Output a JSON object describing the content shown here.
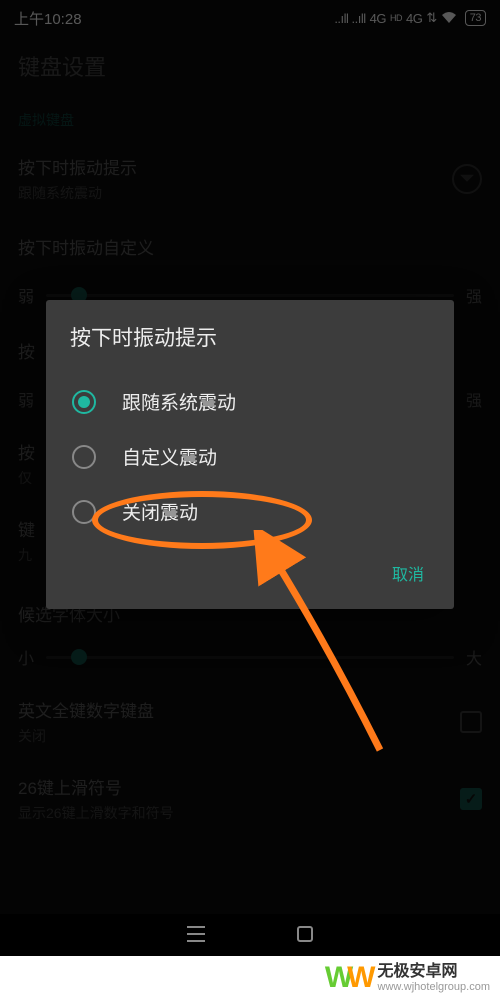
{
  "status": {
    "time": "上午10:28",
    "signal": "..ıll ..ıll",
    "net1": "4G",
    "hd": "HD",
    "net2": "4G",
    "wifi": "⇅",
    "battery": "73"
  },
  "page": {
    "title": "键盘设置",
    "section1": "虚拟键盘"
  },
  "items": {
    "vibrate": {
      "title": "按下时振动提示",
      "sub": "跟随系统震动"
    },
    "vibrate_custom": {
      "title": "按下时振动自定义"
    },
    "slider1": {
      "min": "弱",
      "max": "强",
      "pos": 8
    },
    "item3": {
      "title": "按"
    },
    "slider2": {
      "min": "弱",
      "max": "强",
      "pos": 8
    },
    "item4": {
      "title": "按",
      "sub": "仅"
    },
    "item5": {
      "title": "键",
      "sub": "九"
    },
    "font_size": {
      "title": "候选字体大小"
    },
    "slider3": {
      "min": "小",
      "max": "大",
      "pos": 8
    },
    "en_numpad": {
      "title": "英文全键数字键盘",
      "sub": "关闭"
    },
    "key26": {
      "title": "26键上滑符号",
      "sub": "显示26键上滑数字和符号"
    }
  },
  "dialog": {
    "title": "按下时振动提示",
    "options": [
      {
        "label": "跟随系统震动",
        "selected": true
      },
      {
        "label": "自定义震动",
        "selected": false
      },
      {
        "label": "关闭震动",
        "selected": false
      }
    ],
    "cancel": "取消"
  },
  "watermark": {
    "title": "无极安卓网",
    "sub": "www.wjhotelgroup.com"
  }
}
